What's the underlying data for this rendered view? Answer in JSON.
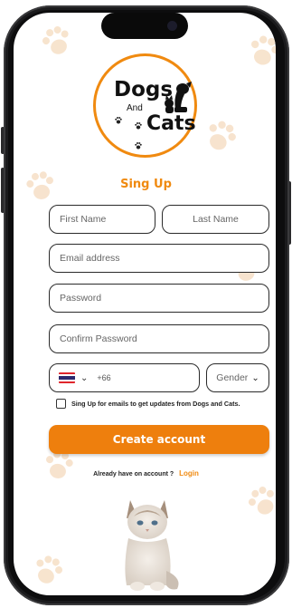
{
  "logo": {
    "line1": "Dogs",
    "line2": "And",
    "line3": "Cats"
  },
  "form": {
    "title": "Sing Up",
    "first_name_placeholder": "First Name",
    "last_name_placeholder": "Last Name",
    "email_placeholder": "Email address",
    "password_placeholder": "Password",
    "confirm_password_placeholder": "Confirm Password",
    "country_flag": "thailand-flag",
    "dial_code": "+66",
    "gender_label": "Gender",
    "newsletter_label": "Sing Up for emails to get updates from  Dogs and Cats.",
    "newsletter_checked": false,
    "submit_label": "Create account",
    "login_prompt": "Already have on account ?",
    "login_link": "Login"
  },
  "colors": {
    "accent": "#f08a10",
    "button": "#ee7f0d",
    "paw": "#f7e1c9",
    "border": "#2a2a2a"
  }
}
